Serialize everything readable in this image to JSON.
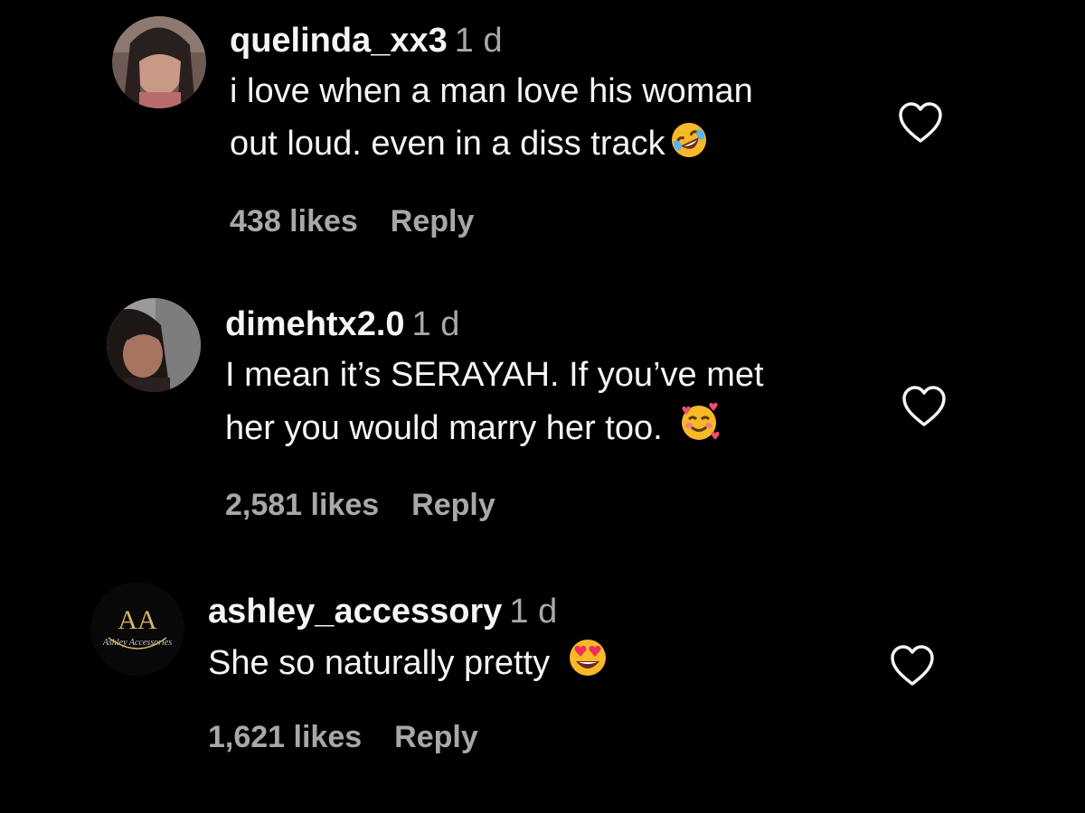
{
  "comments": [
    {
      "username": "quelinda_xx3",
      "time": "1 d",
      "text_lines": [
        "i love when a man love his woman",
        "out loud. even in a diss track"
      ],
      "trailing_emoji": "rolling-on-floor-laughing-emoji",
      "likes": "438 likes",
      "reply": "Reply",
      "avatar": "profile-photo-avatar"
    },
    {
      "username": "dimehtx2.0",
      "time": "1 d",
      "text_lines": [
        "I mean it’s SERAYAH. If you’ve met",
        "her you would marry her too."
      ],
      "trailing_emoji": "smiling-face-with-hearts-emoji",
      "likes": "2,581 likes",
      "reply": "Reply",
      "avatar": "profile-photo-avatar"
    },
    {
      "username": "ashley_accessory",
      "time": "1 d",
      "text_lines": [
        "She so naturally pretty"
      ],
      "trailing_emoji": "heart-eyes-emoji",
      "likes": "1,621 likes",
      "reply": "Reply",
      "avatar": "logo-avatar",
      "avatar_logo_text": "AA",
      "avatar_logo_script": "Ashley Accessories"
    }
  ],
  "colors": {
    "background": "#000000",
    "primary_text": "#f5f5f5",
    "secondary_text": "#a8a8a8"
  }
}
